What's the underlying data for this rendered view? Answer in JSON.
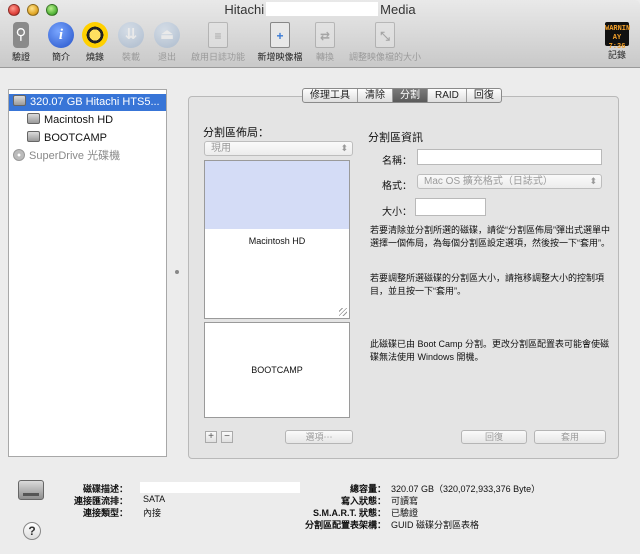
{
  "window": {
    "title_left": "Hitachi",
    "title_right": "Media"
  },
  "toolbar": {
    "verify": "驗證",
    "info": "簡介",
    "burn": "燒錄",
    "mount": "裝載",
    "eject": "退出",
    "enable_journaling": "啟用日誌功能",
    "new_image": "新增映像檔",
    "convert": "轉換",
    "resize_image": "調整映像檔的大小",
    "log": "記錄",
    "log_icon_text": [
      "WARNIN",
      "AY 7:36"
    ]
  },
  "sidebar": {
    "items": [
      {
        "label": "320.07 GB Hitachi HTS5..."
      },
      {
        "label": "Macintosh HD"
      },
      {
        "label": "BOOTCAMP"
      },
      {
        "label": "SuperDrive 光碟機"
      }
    ]
  },
  "tabs": [
    "修理工具",
    "清除",
    "分割",
    "RAID",
    "回復"
  ],
  "partition": {
    "layout_label": "分割區佈局：",
    "layout_value": "現用",
    "partitions": [
      "Macintosh HD",
      "BOOTCAMP"
    ],
    "used_fraction": 0.43,
    "add_label": "+",
    "remove_label": "−",
    "options_label": "選項⋯",
    "info_title": "分割區資訊",
    "name_label": "名稱：",
    "format_label": "格式：",
    "format_value": "Mac OS 擴充格式（日誌式）",
    "size_label": "大小：",
    "para1": "若要清除並分割所選的磁碟，請從“分割區佈局”彈出式選單中選擇一個佈局，為每個分割區設定選項，然後按一下“套用”。",
    "para2": "若要調整所選磁碟的分割區大小，請拖移調整大小的控制項目，並且按一下“套用”。",
    "para3": "此磁碟已由 Boot Camp 分割。更改分割區配置表可能會使磁碟無法使用 Windows 開機。",
    "revert_label": "回復",
    "apply_label": "套用"
  },
  "info": {
    "desc_label": "磁碟描述：",
    "bus_label": "連接匯流排：",
    "bus_value": "SATA",
    "type_label": "連接類型：",
    "type_value": "內接",
    "capacity_label": "總容量：",
    "capacity_value": "320.07 GB（320,072,933,376 Byte）",
    "write_label": "寫入狀態：",
    "write_value": "可讀寫",
    "smart_label": "S.M.A.R.T. 狀態：",
    "smart_value": "已驗證",
    "scheme_label": "分割區配置表架構：",
    "scheme_value": "GUID 磁碟分割區表格"
  },
  "help_label": "?"
}
